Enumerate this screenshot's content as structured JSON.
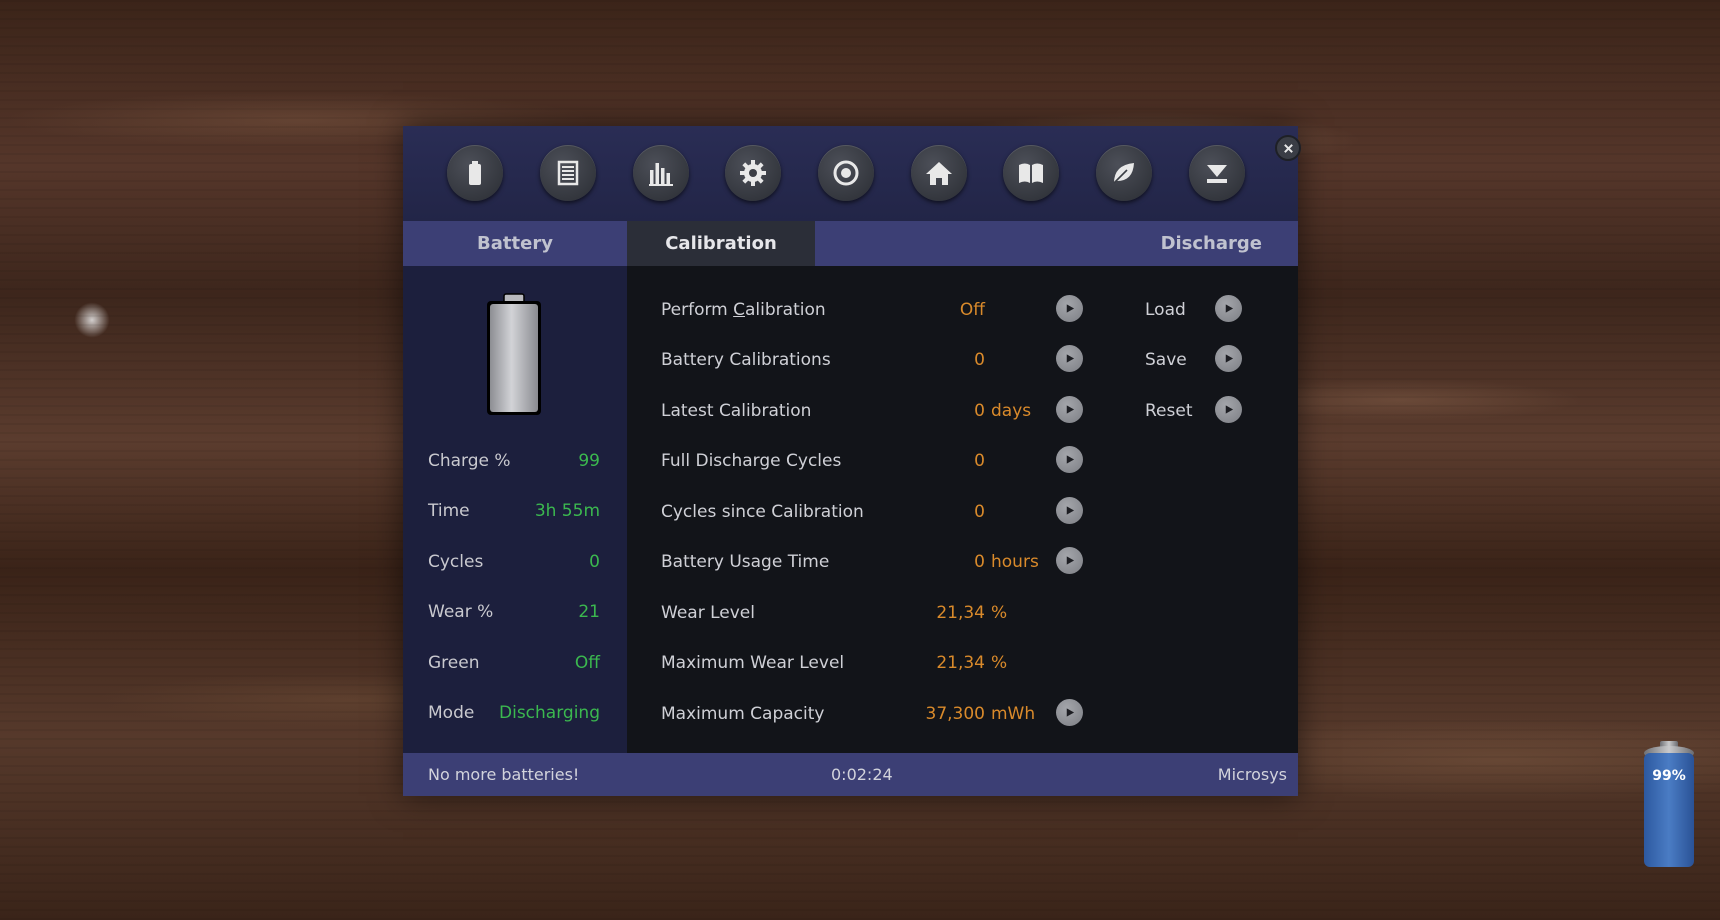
{
  "toolbar": {
    "icons": [
      "battery-icon",
      "list-icon",
      "bar-chart-icon",
      "gear-icon",
      "target-icon",
      "home-icon",
      "book-icon",
      "leaf-icon",
      "download-icon"
    ]
  },
  "tabs": {
    "battery": "Battery",
    "calibration": "Calibration",
    "discharge": "Discharge"
  },
  "battery_stats": [
    {
      "label": "Charge %",
      "value": "99"
    },
    {
      "label": "Time",
      "value": "3h 55m"
    },
    {
      "label": "Cycles",
      "value": "0"
    },
    {
      "label": "Wear %",
      "value": "21"
    },
    {
      "label": "Green",
      "value": "Off"
    },
    {
      "label": "Mode",
      "value": "Discharging"
    }
  ],
  "calibration": [
    {
      "label_pre": "Perform ",
      "label_ul": "C",
      "label_post": "alibration",
      "value": "Off",
      "unit": ""
    },
    {
      "label": "Battery Calibrations",
      "value": "0",
      "unit": ""
    },
    {
      "label": "Latest Calibration",
      "value": "0",
      "unit": "days"
    },
    {
      "label": "Full Discharge Cycles",
      "value": "0",
      "unit": ""
    },
    {
      "label": "Cycles since Calibration",
      "value": "0",
      "unit": ""
    },
    {
      "label": "Battery Usage Time",
      "value": "0",
      "unit": "hours"
    },
    {
      "label": "Wear Level",
      "value": "21,34",
      "unit": "%"
    },
    {
      "label": "Maximum Wear Level",
      "value": "21,34",
      "unit": "%"
    },
    {
      "label": "Maximum Capacity",
      "value": "37,300",
      "unit": "mWh"
    }
  ],
  "actions": {
    "load": "Load",
    "save": "Save",
    "reset": "Reset"
  },
  "status": {
    "message": "No more batteries!",
    "timer": "0:02:24",
    "brand": "Microsys"
  },
  "tray": {
    "level_text": "99%",
    "level": 0.99
  },
  "colors": {
    "accent_value_green": "#3bb84f",
    "accent_value_orange": "#d98a2b",
    "header_bg": "#3c3f75"
  }
}
